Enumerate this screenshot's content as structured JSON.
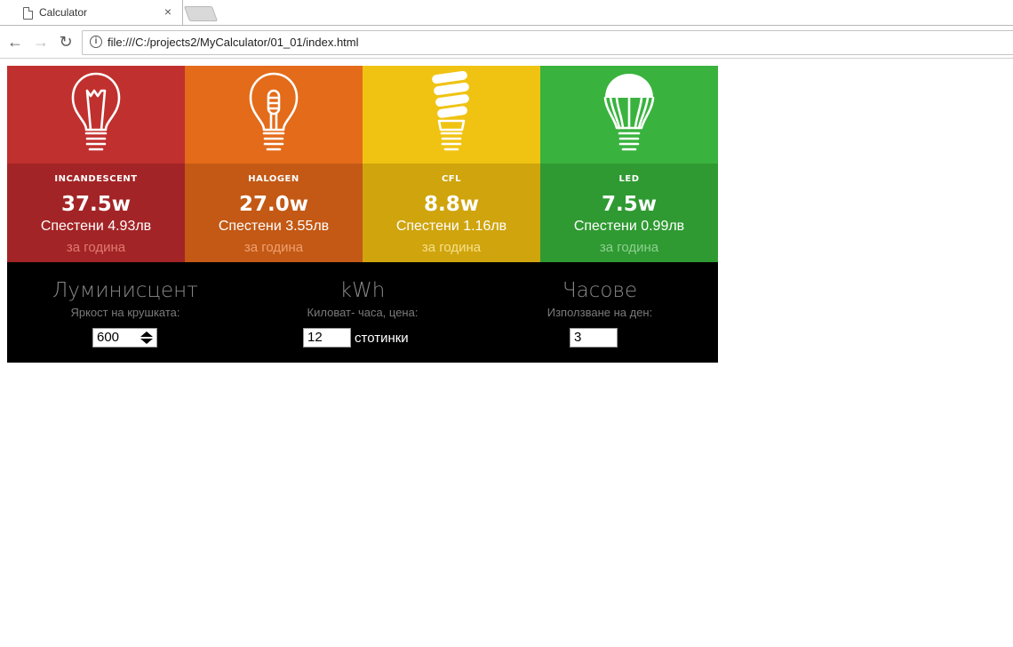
{
  "browser": {
    "tab_title": "Calculator",
    "tab_close": "×",
    "url": "file:///C:/projects2/MyCalculator/01_01/index.html",
    "back_icon": "←",
    "forward_icon": "→",
    "reload_icon": "↻",
    "info_icon": "i"
  },
  "bulbs": [
    {
      "name": "INCANDESCENT",
      "watt": "37.5w",
      "saved": "Спестени 4.93лв",
      "period": "за година",
      "top_color": "#c0302e",
      "bottom_color": "#a32426",
      "period_color": "#e07a72",
      "icon": "incandescent-bulb-icon"
    },
    {
      "name": "HALOGEN",
      "watt": "27.0w",
      "saved": "Спестени 3.55лв",
      "period": "за година",
      "top_color": "#e36b19",
      "bottom_color": "#c35915",
      "period_color": "#f0a070",
      "icon": "halogen-bulb-icon"
    },
    {
      "name": "CFL",
      "watt": "8.8w",
      "saved": "Спестени 1.16лв",
      "period": "за година",
      "top_color": "#f0c313",
      "bottom_color": "#cfa40d",
      "period_color": "#f7e08a",
      "icon": "cfl-bulb-icon"
    },
    {
      "name": "LED",
      "watt": "7.5w",
      "saved": "Спестени 0.99лв",
      "period": "за година",
      "top_color": "#39b33e",
      "bottom_color": "#2f9a32",
      "period_color": "#8ed08f",
      "icon": "led-bulb-icon"
    }
  ],
  "inputs": {
    "lumens": {
      "title": "Луминисцент",
      "subtitle": "Яркост на крушката:",
      "value": "600"
    },
    "kwh": {
      "title": "kWh",
      "subtitle": "Киловат- часа, цена:",
      "value": "12",
      "unit": "стотинки"
    },
    "hours": {
      "title": "Часове",
      "subtitle": "Използване на ден:",
      "value": "3"
    }
  }
}
